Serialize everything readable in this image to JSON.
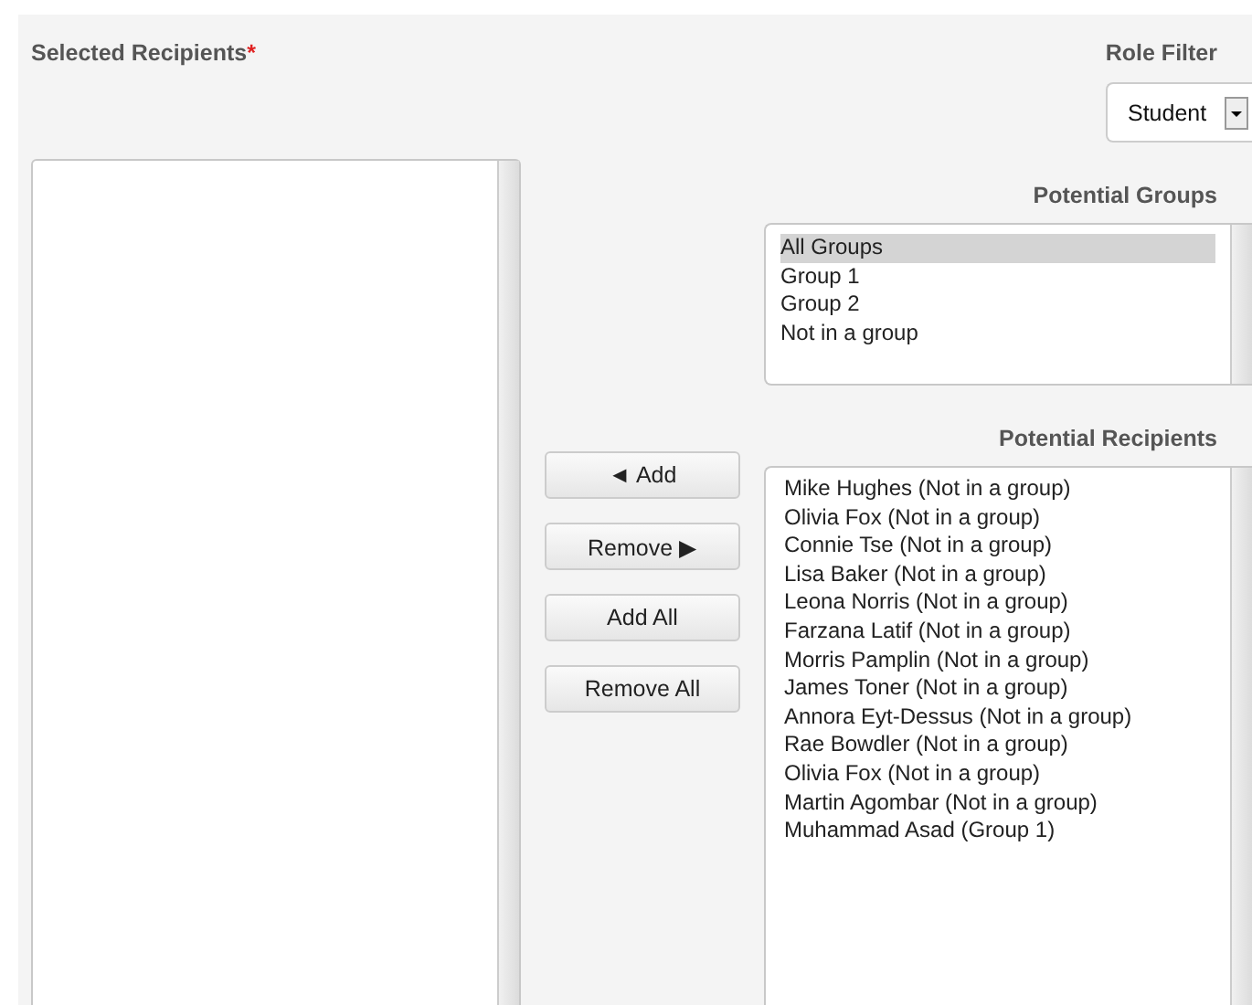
{
  "selected_recipients": {
    "label": "Selected Recipients",
    "required_mark": "*"
  },
  "role_filter": {
    "label": "Role Filter",
    "value": "Student"
  },
  "buttons": [
    "◄ Add",
    "Remove ▶",
    "Add All",
    "Remove All"
  ],
  "potential_groups": {
    "label": "Potential Groups",
    "items": [
      {
        "label": "All Groups",
        "selected": true
      },
      {
        "label": "Group 1",
        "selected": false
      },
      {
        "label": "Group 2",
        "selected": false
      },
      {
        "label": "Not in a group",
        "selected": false
      }
    ]
  },
  "potential_recipients": {
    "label": "Potential Recipients",
    "items": [
      {
        "label": "Mike Hughes (Not in a group)",
        "selected": false
      },
      {
        "label": "Olivia Fox (Not in a group)",
        "selected": false
      },
      {
        "label": "Connie Tse (Not in a group)",
        "selected": false
      },
      {
        "label": "Lisa Baker (Not in a group)",
        "selected": false
      },
      {
        "label": "Leona Norris (Not in a group)",
        "selected": false
      },
      {
        "label": "Farzana Latif (Not in a group)",
        "selected": false
      },
      {
        "label": "Morris Pamplin (Not in a group)",
        "selected": false
      },
      {
        "label": "James Toner (Not in a group)",
        "selected": false
      },
      {
        "label": "Annora Eyt-Dessus (Not in a group)",
        "selected": false
      },
      {
        "label": "Rae Bowdler (Not in a group)",
        "selected": false
      },
      {
        "label": "Olivia Fox (Not in a group)",
        "selected": false
      },
      {
        "label": "Martin Agombar (Not in a group)",
        "selected": false
      },
      {
        "label": "Muhammad Asad (Group 1)",
        "selected": false
      }
    ]
  }
}
